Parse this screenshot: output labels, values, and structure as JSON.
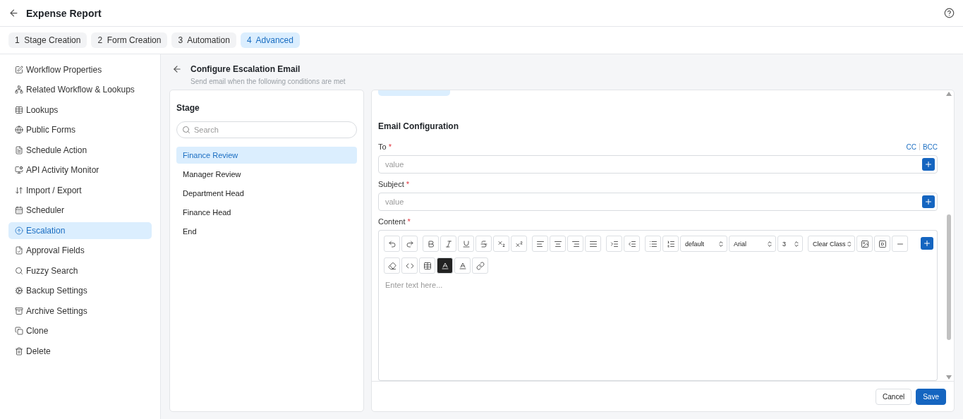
{
  "header": {
    "title": "Expense Report"
  },
  "steps": [
    {
      "number": "1",
      "label": "Stage Creation",
      "selected": false
    },
    {
      "number": "2",
      "label": "Form Creation",
      "selected": false
    },
    {
      "number": "3",
      "label": "Automation",
      "selected": false
    },
    {
      "number": "4",
      "label": "Advanced",
      "selected": true
    }
  ],
  "sidebar": {
    "items": [
      {
        "label": "Workflow Properties",
        "selected": false
      },
      {
        "label": "Related Workflow & Lookups",
        "selected": false
      },
      {
        "label": "Lookups",
        "selected": false
      },
      {
        "label": "Public Forms",
        "selected": false
      },
      {
        "label": "Schedule Action",
        "selected": false
      },
      {
        "label": "API Activity Monitor",
        "selected": false
      },
      {
        "label": "Import / Export",
        "selected": false
      },
      {
        "label": "Scheduler",
        "selected": false
      },
      {
        "label": "Escalation",
        "selected": true
      },
      {
        "label": "Approval Fields",
        "selected": false
      },
      {
        "label": "Fuzzy Search",
        "selected": false
      },
      {
        "label": "Backup Settings",
        "selected": false
      },
      {
        "label": "Archive Settings",
        "selected": false
      },
      {
        "label": "Clone",
        "selected": false
      },
      {
        "label": "Delete",
        "selected": false
      }
    ]
  },
  "page": {
    "title": "Configure Escalation Email",
    "subtitle": "Send email when the following conditions are met"
  },
  "stage_panel": {
    "title": "Stage",
    "search": {
      "placeholder": "Search"
    },
    "stages": [
      {
        "label": "Finance Review",
        "selected": true
      },
      {
        "label": "Manager Review",
        "selected": false
      },
      {
        "label": "Department Head",
        "selected": false
      },
      {
        "label": "Finance Head",
        "selected": false
      },
      {
        "label": "End",
        "selected": false
      }
    ]
  },
  "email": {
    "title": "Email Configuration",
    "to": {
      "label": "To",
      "required": "*",
      "placeholder": "value",
      "links": [
        "CC",
        "BCC"
      ]
    },
    "subject": {
      "label": "Subject",
      "required": "*",
      "placeholder": "value"
    },
    "content": {
      "label": "Content",
      "required": "*",
      "placeholder": "Enter text here...",
      "toolbar": [
        {
          "kind": "undo"
        },
        {
          "kind": "redo"
        },
        {
          "kind": "gap"
        },
        {
          "kind": "bold"
        },
        {
          "kind": "italic"
        },
        {
          "kind": "underline"
        },
        {
          "kind": "strike"
        },
        {
          "kind": "sub"
        },
        {
          "kind": "sup"
        },
        {
          "kind": "gap"
        },
        {
          "kind": "left"
        },
        {
          "kind": "center"
        },
        {
          "kind": "right"
        },
        {
          "kind": "justify"
        },
        {
          "kind": "gap"
        },
        {
          "kind": "indent"
        },
        {
          "kind": "outdent"
        },
        {
          "kind": "gap"
        },
        {
          "kind": "bullets"
        },
        {
          "kind": "numbers"
        },
        {
          "kind": "select",
          "value": "default"
        },
        {
          "kind": "select",
          "value": "Arial"
        },
        {
          "kind": "select",
          "value": "3"
        },
        {
          "kind": "gap"
        },
        {
          "kind": "select",
          "value": "Clear Class"
        },
        {
          "kind": "image"
        },
        {
          "kind": "video"
        },
        {
          "kind": "rule"
        },
        {
          "kind": "break"
        },
        {
          "kind": "eraser"
        },
        {
          "kind": "code"
        },
        {
          "kind": "table"
        },
        {
          "kind": "highlight"
        },
        {
          "kind": "color"
        },
        {
          "kind": "link"
        }
      ]
    }
  },
  "footer": {
    "buttons": [
      {
        "label": "Cancel",
        "kind": "secondary"
      },
      {
        "label": "Save",
        "kind": "primary"
      }
    ]
  }
}
